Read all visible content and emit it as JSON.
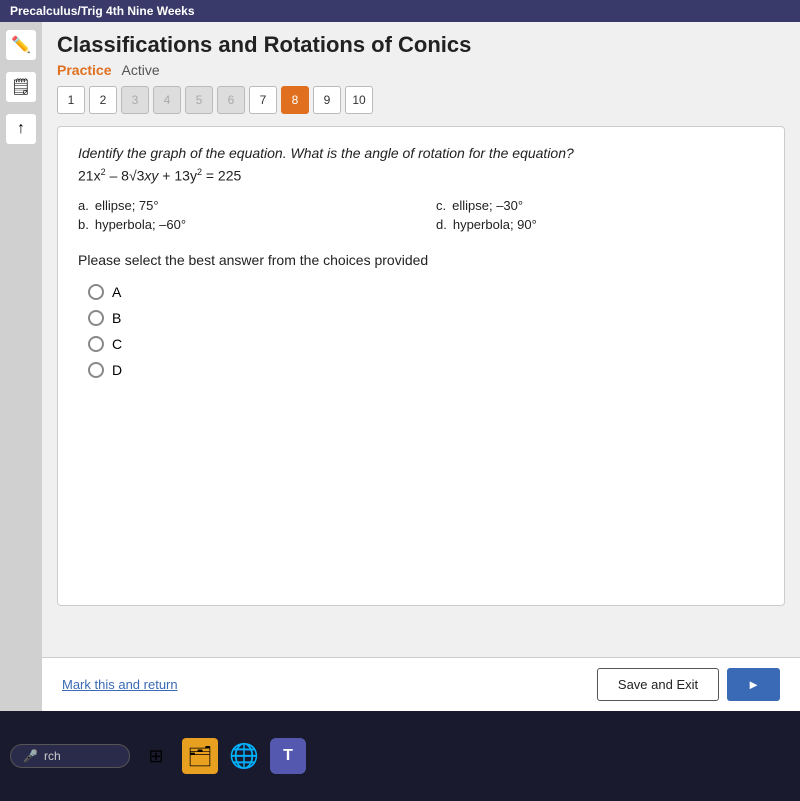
{
  "topbar": {
    "label": "Precalculus/Trig 4th Nine Weeks"
  },
  "header": {
    "title": "Classifications and Rotations of Conics",
    "status_practice": "Practice",
    "status_separator": "—",
    "status_active": "Active"
  },
  "question_nav": {
    "buttons": [
      {
        "label": "1",
        "state": "normal"
      },
      {
        "label": "2",
        "state": "normal"
      },
      {
        "label": "3",
        "state": "disabled"
      },
      {
        "label": "4",
        "state": "disabled"
      },
      {
        "label": "5",
        "state": "disabled"
      },
      {
        "label": "6",
        "state": "disabled"
      },
      {
        "label": "7",
        "state": "normal"
      },
      {
        "label": "8",
        "state": "current"
      },
      {
        "label": "9",
        "state": "normal"
      },
      {
        "label": "10",
        "state": "normal"
      }
    ]
  },
  "question": {
    "prompt": "Identify the graph of the equation. What is the angle of rotation for the equation?",
    "equation": "21x² – 8√3xy + 13y² = 225",
    "choices": [
      {
        "letter": "a.",
        "text": "ellipse; 75°"
      },
      {
        "letter": "b.",
        "text": "hyperbola; –60°"
      },
      {
        "letter": "c.",
        "text": "ellipse; –30°"
      },
      {
        "letter": "d.",
        "text": "hyperbola; 90°"
      }
    ],
    "answer_prompt": "Please select the best answer from the choices provided",
    "options": [
      {
        "label": "A"
      },
      {
        "label": "B"
      },
      {
        "label": "C"
      },
      {
        "label": "D"
      }
    ]
  },
  "footer": {
    "mark_link": "Mark this and return",
    "save_exit_label": "Save and Exit",
    "next_label": "►"
  },
  "taskbar": {
    "search_placeholder": "rch",
    "icons": [
      {
        "name": "taskbar-search-icon",
        "symbol": "🔍"
      },
      {
        "name": "taskbar-files-icon",
        "symbol": "🗂"
      },
      {
        "name": "taskbar-chrome-icon",
        "symbol": "⊙"
      },
      {
        "name": "taskbar-teams-icon",
        "symbol": "T"
      }
    ]
  }
}
